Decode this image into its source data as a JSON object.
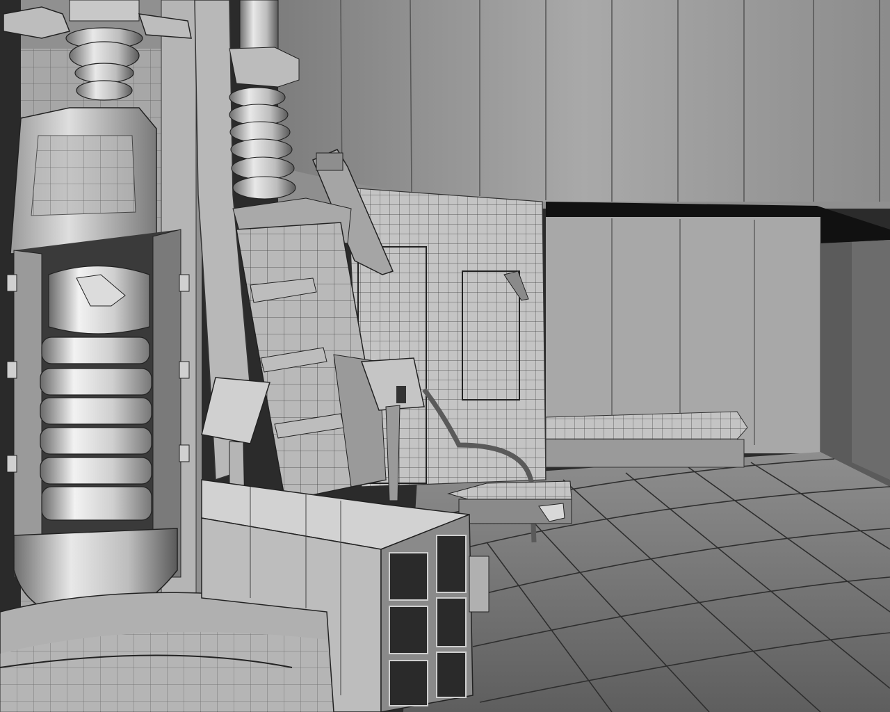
{
  "scene": {
    "kind": "3d-wireframe-shaded-render",
    "palette": {
      "shadow": "#1f1f1f",
      "dark": "#4a4a4a",
      "mid": "#8a8a8a",
      "light": "#c9c9c9",
      "highlight": "#ececec",
      "wire": "#2a2a2a"
    }
  }
}
